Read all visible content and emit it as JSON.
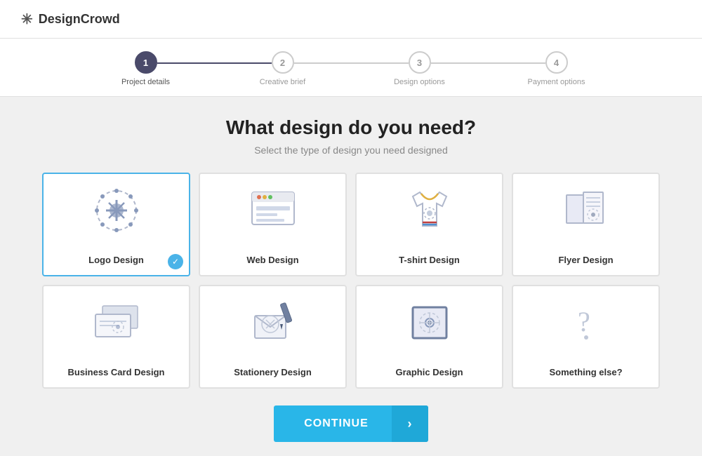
{
  "header": {
    "logo_text": "DesignCrowd"
  },
  "steps": [
    {
      "number": "1",
      "label": "Project details",
      "active": true,
      "line_filled": true
    },
    {
      "number": "2",
      "label": "Creative brief",
      "active": false,
      "line_filled": false
    },
    {
      "number": "3",
      "label": "Design options",
      "active": false,
      "line_filled": false
    },
    {
      "number": "4",
      "label": "Payment options",
      "active": false,
      "line_filled": false
    }
  ],
  "main": {
    "title": "What design do you need?",
    "subtitle": "Select the type of design you need designed"
  },
  "cards": [
    {
      "id": "logo",
      "label": "Logo Design",
      "selected": true
    },
    {
      "id": "web",
      "label": "Web Design",
      "selected": false
    },
    {
      "id": "tshirt",
      "label": "T-shirt Design",
      "selected": false
    },
    {
      "id": "flyer",
      "label": "Flyer Design",
      "selected": false
    },
    {
      "id": "bizcard",
      "label": "Business Card Design",
      "selected": false
    },
    {
      "id": "stationery",
      "label": "Stationery Design",
      "selected": false
    },
    {
      "id": "graphic",
      "label": "Graphic Design",
      "selected": false
    },
    {
      "id": "other",
      "label": "Something else?",
      "selected": false
    }
  ],
  "continue_button": {
    "label": "CONTINUE"
  }
}
